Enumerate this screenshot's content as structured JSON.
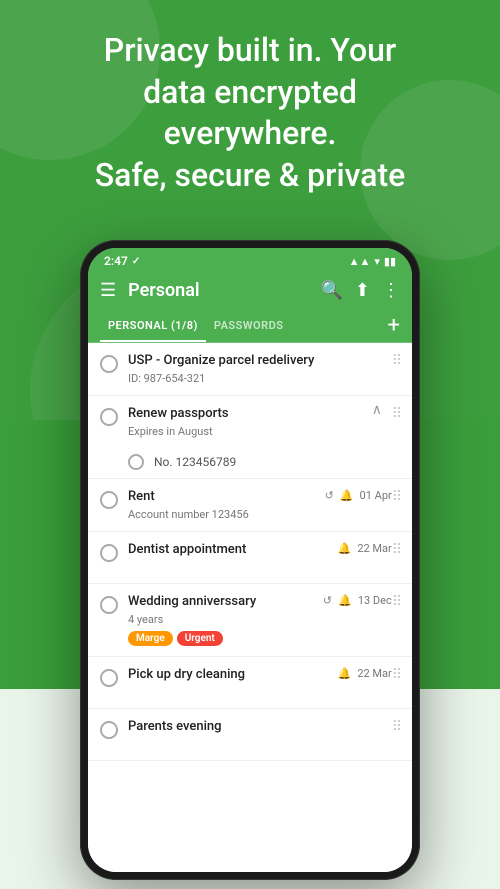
{
  "hero": {
    "text_line1": "Privacy built in. Your",
    "text_line2": "data encrypted",
    "text_line3": "everywhere.",
    "text_line4": "Safe, secure & private"
  },
  "status_bar": {
    "time": "2:47",
    "check": "✓"
  },
  "toolbar": {
    "title": "Personal",
    "menu_icon": "☰",
    "search_icon": "🔍",
    "share_icon": "⬆",
    "more_icon": "⋮"
  },
  "tabs": [
    {
      "label": "PERSONAL (1/8)",
      "active": true
    },
    {
      "label": "PASSWORDS",
      "active": false
    }
  ],
  "tab_add_label": "+",
  "list_items": [
    {
      "id": 1,
      "title": "USP - Organize parcel redelivery",
      "subtitle": "ID: 987-654-321",
      "date": "",
      "repeat": false,
      "bell": false,
      "tags": [],
      "expanded": false,
      "sub_items": []
    },
    {
      "id": 2,
      "title": "Renew passports",
      "subtitle": "Expires in August",
      "date": "",
      "repeat": false,
      "bell": false,
      "tags": [],
      "expanded": true,
      "sub_items": [
        {
          "label": "No. 123456789"
        }
      ]
    },
    {
      "id": 3,
      "title": "Rent",
      "subtitle": "Account number 123456",
      "date": "01 Apr",
      "repeat": true,
      "bell": true,
      "tags": [],
      "expanded": false,
      "sub_items": []
    },
    {
      "id": 4,
      "title": "Dentist appointment",
      "subtitle": "",
      "date": "22 Mar",
      "repeat": false,
      "bell": true,
      "tags": [],
      "expanded": false,
      "sub_items": []
    },
    {
      "id": 5,
      "title": "Wedding anniverssary",
      "subtitle": "4 years",
      "date": "13 Dec",
      "repeat": true,
      "bell": true,
      "tags": [
        {
          "text": "Marge",
          "class": "tag-marge"
        },
        {
          "text": "Urgent",
          "class": "tag-urgent"
        }
      ],
      "expanded": false,
      "sub_items": []
    },
    {
      "id": 6,
      "title": "Pick up dry cleaning",
      "subtitle": "",
      "date": "22 Mar",
      "repeat": false,
      "bell": true,
      "tags": [],
      "expanded": false,
      "sub_items": []
    },
    {
      "id": 7,
      "title": "Parents evening",
      "subtitle": "",
      "date": "",
      "repeat": false,
      "bell": false,
      "tags": [],
      "expanded": false,
      "sub_items": []
    }
  ]
}
